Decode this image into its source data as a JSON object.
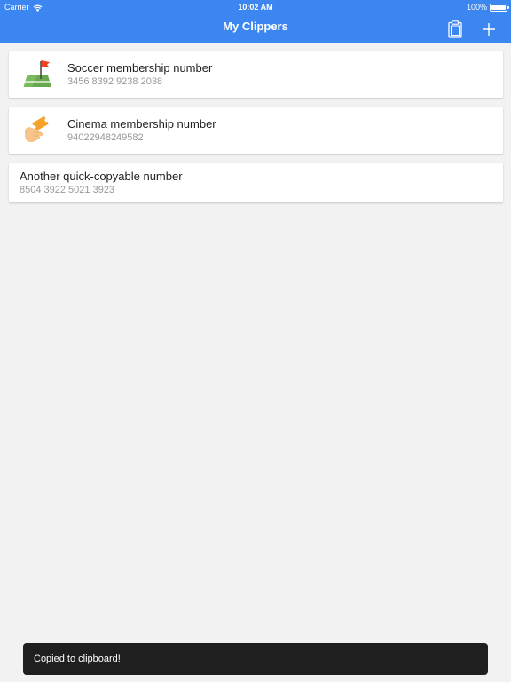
{
  "status_bar": {
    "carrier": "Carrier",
    "time": "10:02 AM",
    "battery": "100%"
  },
  "nav": {
    "title": "My Clippers"
  },
  "clippers": [
    {
      "title": "Soccer membership number",
      "value": "3456 8392 9238 2038",
      "icon": "soccer-field-flag-icon"
    },
    {
      "title": "Cinema membership number",
      "value": "94022948249582",
      "icon": "hand-holding-ticket-icon"
    },
    {
      "title": "Another quick-copyable number",
      "value": "8504 3922 5021 3923",
      "icon": null
    }
  ],
  "toast": {
    "message": "Copied to clipboard!"
  },
  "colors": {
    "accent": "#3c86f1",
    "background": "#f2f2f2",
    "toast": "#1f1f1f"
  }
}
